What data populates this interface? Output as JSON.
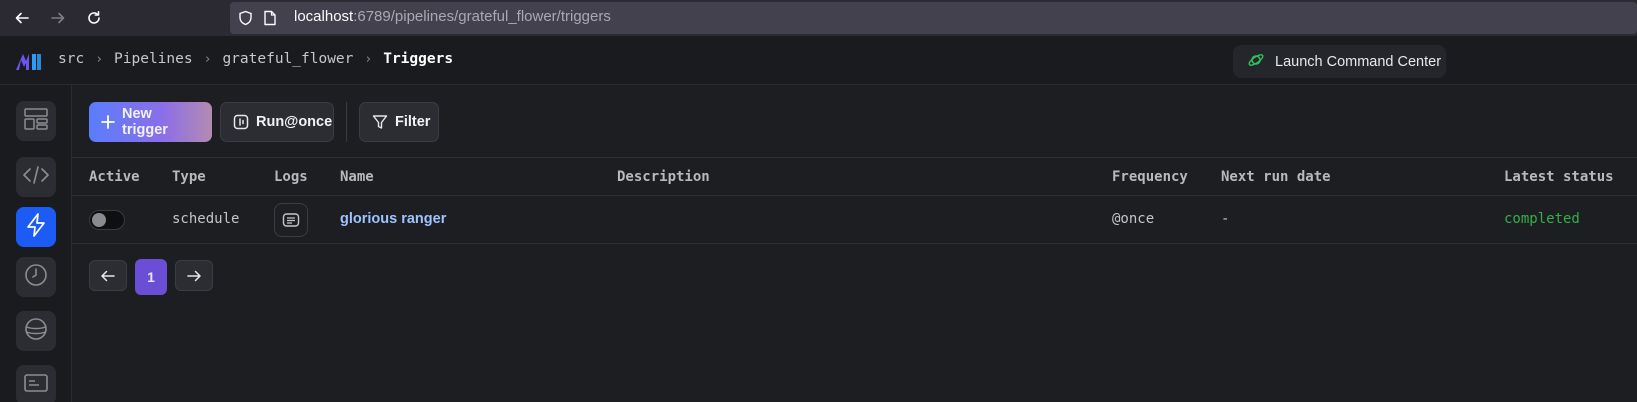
{
  "browser": {
    "url_host": "localhost",
    "url_rest": ":6789/pipelines/grateful_flower/triggers"
  },
  "header": {
    "breadcrumbs": [
      "src",
      "Pipelines",
      "grateful_flower",
      "Triggers"
    ],
    "command_center_label": "Launch Command Center"
  },
  "sidebar": {
    "items": [
      {
        "icon": "dashboard-icon"
      },
      {
        "icon": "code-icon"
      },
      {
        "icon": "lightning-icon",
        "active": true
      },
      {
        "icon": "clock-icon"
      },
      {
        "icon": "planet-icon"
      },
      {
        "icon": "terminal-icon"
      }
    ]
  },
  "toolbar": {
    "new_trigger_label": "New trigger",
    "run_once_label": "Run@once",
    "filter_label": "Filter"
  },
  "table": {
    "columns": [
      "Active",
      "Type",
      "Logs",
      "Name",
      "Description",
      "Frequency",
      "Next run date",
      "Latest status"
    ],
    "rows": [
      {
        "active": false,
        "type": "schedule",
        "name": "glorious ranger",
        "description": "",
        "frequency": "@once",
        "next_run_date": "-",
        "latest_status": "completed"
      }
    ]
  },
  "pagination": {
    "current_page": "1"
  },
  "colors": {
    "accent": "#1c5cf5",
    "status_completed": "#33b04a",
    "link": "#9ec3ff",
    "page_active": "#6a4fd6"
  }
}
